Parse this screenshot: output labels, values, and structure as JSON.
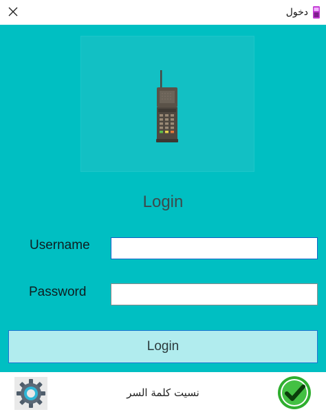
{
  "window": {
    "title": "دخول",
    "close_icon": "close-icon",
    "app_icon": "phone-app-icon"
  },
  "logo": {
    "icon": "mobile-phone-icon"
  },
  "form": {
    "heading": "Login",
    "username_label": "Username",
    "username_value": "",
    "password_label": "Password",
    "password_value": "",
    "submit_label": "Login"
  },
  "footer": {
    "settings_icon": "gear-icon",
    "forgot_password": "نسيت كلمة السر",
    "confirm_icon": "checkmark-icon"
  },
  "colors": {
    "main_bg": "#00bfc2",
    "button_bg": "#b1ecee",
    "button_border": "#1b74d2",
    "input_focus_border": "#0b62c6"
  }
}
